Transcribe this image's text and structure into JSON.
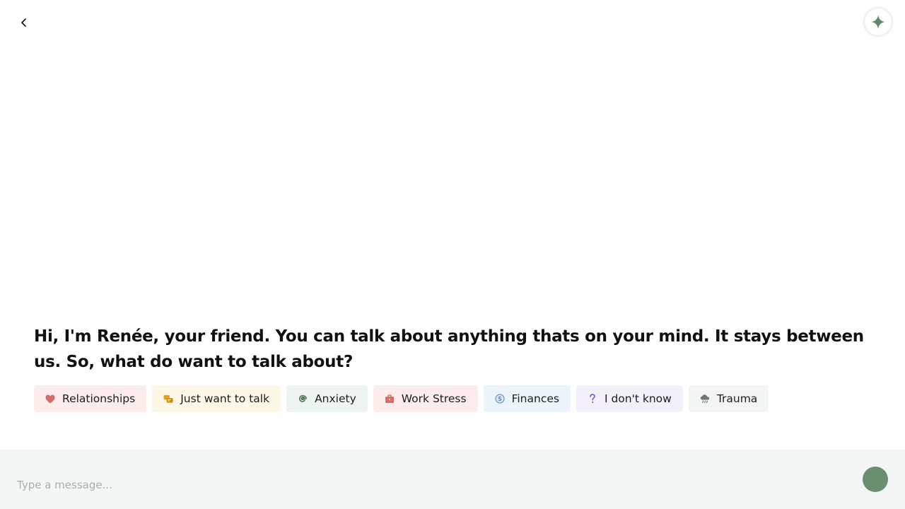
{
  "header": {
    "back_icon": "chevron-left-icon",
    "assistant_icon": "sparkle-icon"
  },
  "intro": {
    "greeting": "Hi, I'm Renée, your friend. You can talk about anything thats on your mind. It stays between us. So, what do want to talk about?"
  },
  "topics": [
    {
      "label": "Relationships",
      "icon": "heart-icon",
      "bg": "#fcecec",
      "color": "#d96a6a"
    },
    {
      "label": "Just want to talk",
      "icon": "chat-bubbles-icon",
      "bg": "#fdf7e6",
      "color": "#e2a21a"
    },
    {
      "label": "Anxiety",
      "icon": "spiral-icon",
      "bg": "#eef5f1",
      "color": "#4f7d5c"
    },
    {
      "label": "Work Stress",
      "icon": "briefcase-icon",
      "bg": "#fcecec",
      "color": "#d96a6a"
    },
    {
      "label": "Finances",
      "icon": "coin-icon",
      "bg": "#eef4fb",
      "color": "#6a92bf"
    },
    {
      "label": "I don't know",
      "icon": "question-icon",
      "bg": "#f3f0fb",
      "color": "#7a63c7"
    },
    {
      "label": "Trauma",
      "icon": "storm-cloud-icon",
      "bg": "#f3f4f4",
      "color": "#6f7372"
    }
  ],
  "composer": {
    "placeholder": "Type a message..."
  },
  "colors": {
    "accent": "#6a8f6f",
    "composer_bg": "#f4f6f5"
  }
}
